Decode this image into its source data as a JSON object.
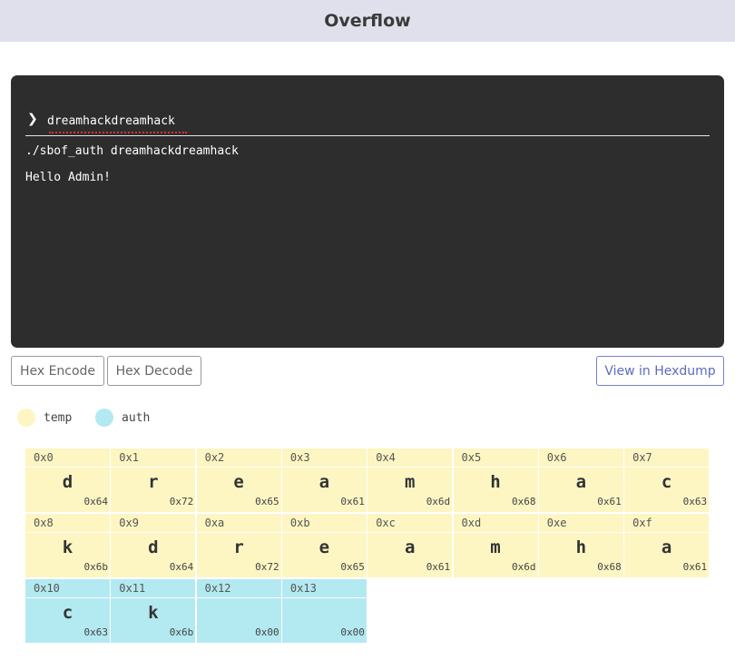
{
  "header": {
    "title": "Overflow"
  },
  "terminal": {
    "prompt_symbol": "❯",
    "input_value": "dreamhackdreamhack",
    "output_lines": [
      "./sbof_auth dreamhackdreamhack",
      "Hello Admin!"
    ]
  },
  "buttons": {
    "hex_encode": "Hex Encode",
    "hex_decode": "Hex Decode",
    "view_hexdump": "View in Hexdump"
  },
  "legend": [
    {
      "label": "temp",
      "color": "#fdf6c3"
    },
    {
      "label": "auth",
      "color": "#b3e9f1"
    }
  ],
  "memory": [
    {
      "addr": "0x0",
      "char": "d",
      "hex": "0x64",
      "region": "temp"
    },
    {
      "addr": "0x1",
      "char": "r",
      "hex": "0x72",
      "region": "temp"
    },
    {
      "addr": "0x2",
      "char": "e",
      "hex": "0x65",
      "region": "temp"
    },
    {
      "addr": "0x3",
      "char": "a",
      "hex": "0x61",
      "region": "temp"
    },
    {
      "addr": "0x4",
      "char": "m",
      "hex": "0x6d",
      "region": "temp"
    },
    {
      "addr": "0x5",
      "char": "h",
      "hex": "0x68",
      "region": "temp"
    },
    {
      "addr": "0x6",
      "char": "a",
      "hex": "0x61",
      "region": "temp"
    },
    {
      "addr": "0x7",
      "char": "c",
      "hex": "0x63",
      "region": "temp"
    },
    {
      "addr": "0x8",
      "char": "k",
      "hex": "0x6b",
      "region": "temp"
    },
    {
      "addr": "0x9",
      "char": "d",
      "hex": "0x64",
      "region": "temp"
    },
    {
      "addr": "0xa",
      "char": "r",
      "hex": "0x72",
      "region": "temp"
    },
    {
      "addr": "0xb",
      "char": "e",
      "hex": "0x65",
      "region": "temp"
    },
    {
      "addr": "0xc",
      "char": "a",
      "hex": "0x61",
      "region": "temp"
    },
    {
      "addr": "0xd",
      "char": "m",
      "hex": "0x6d",
      "region": "temp"
    },
    {
      "addr": "0xe",
      "char": "h",
      "hex": "0x68",
      "region": "temp"
    },
    {
      "addr": "0xf",
      "char": "a",
      "hex": "0x61",
      "region": "temp"
    },
    {
      "addr": "0x10",
      "char": "c",
      "hex": "0x63",
      "region": "auth"
    },
    {
      "addr": "0x11",
      "char": "k",
      "hex": "0x6b",
      "region": "auth"
    },
    {
      "addr": "0x12",
      "char": "",
      "hex": "0x00",
      "region": "auth"
    },
    {
      "addr": "0x13",
      "char": "",
      "hex": "0x00",
      "region": "auth"
    }
  ]
}
